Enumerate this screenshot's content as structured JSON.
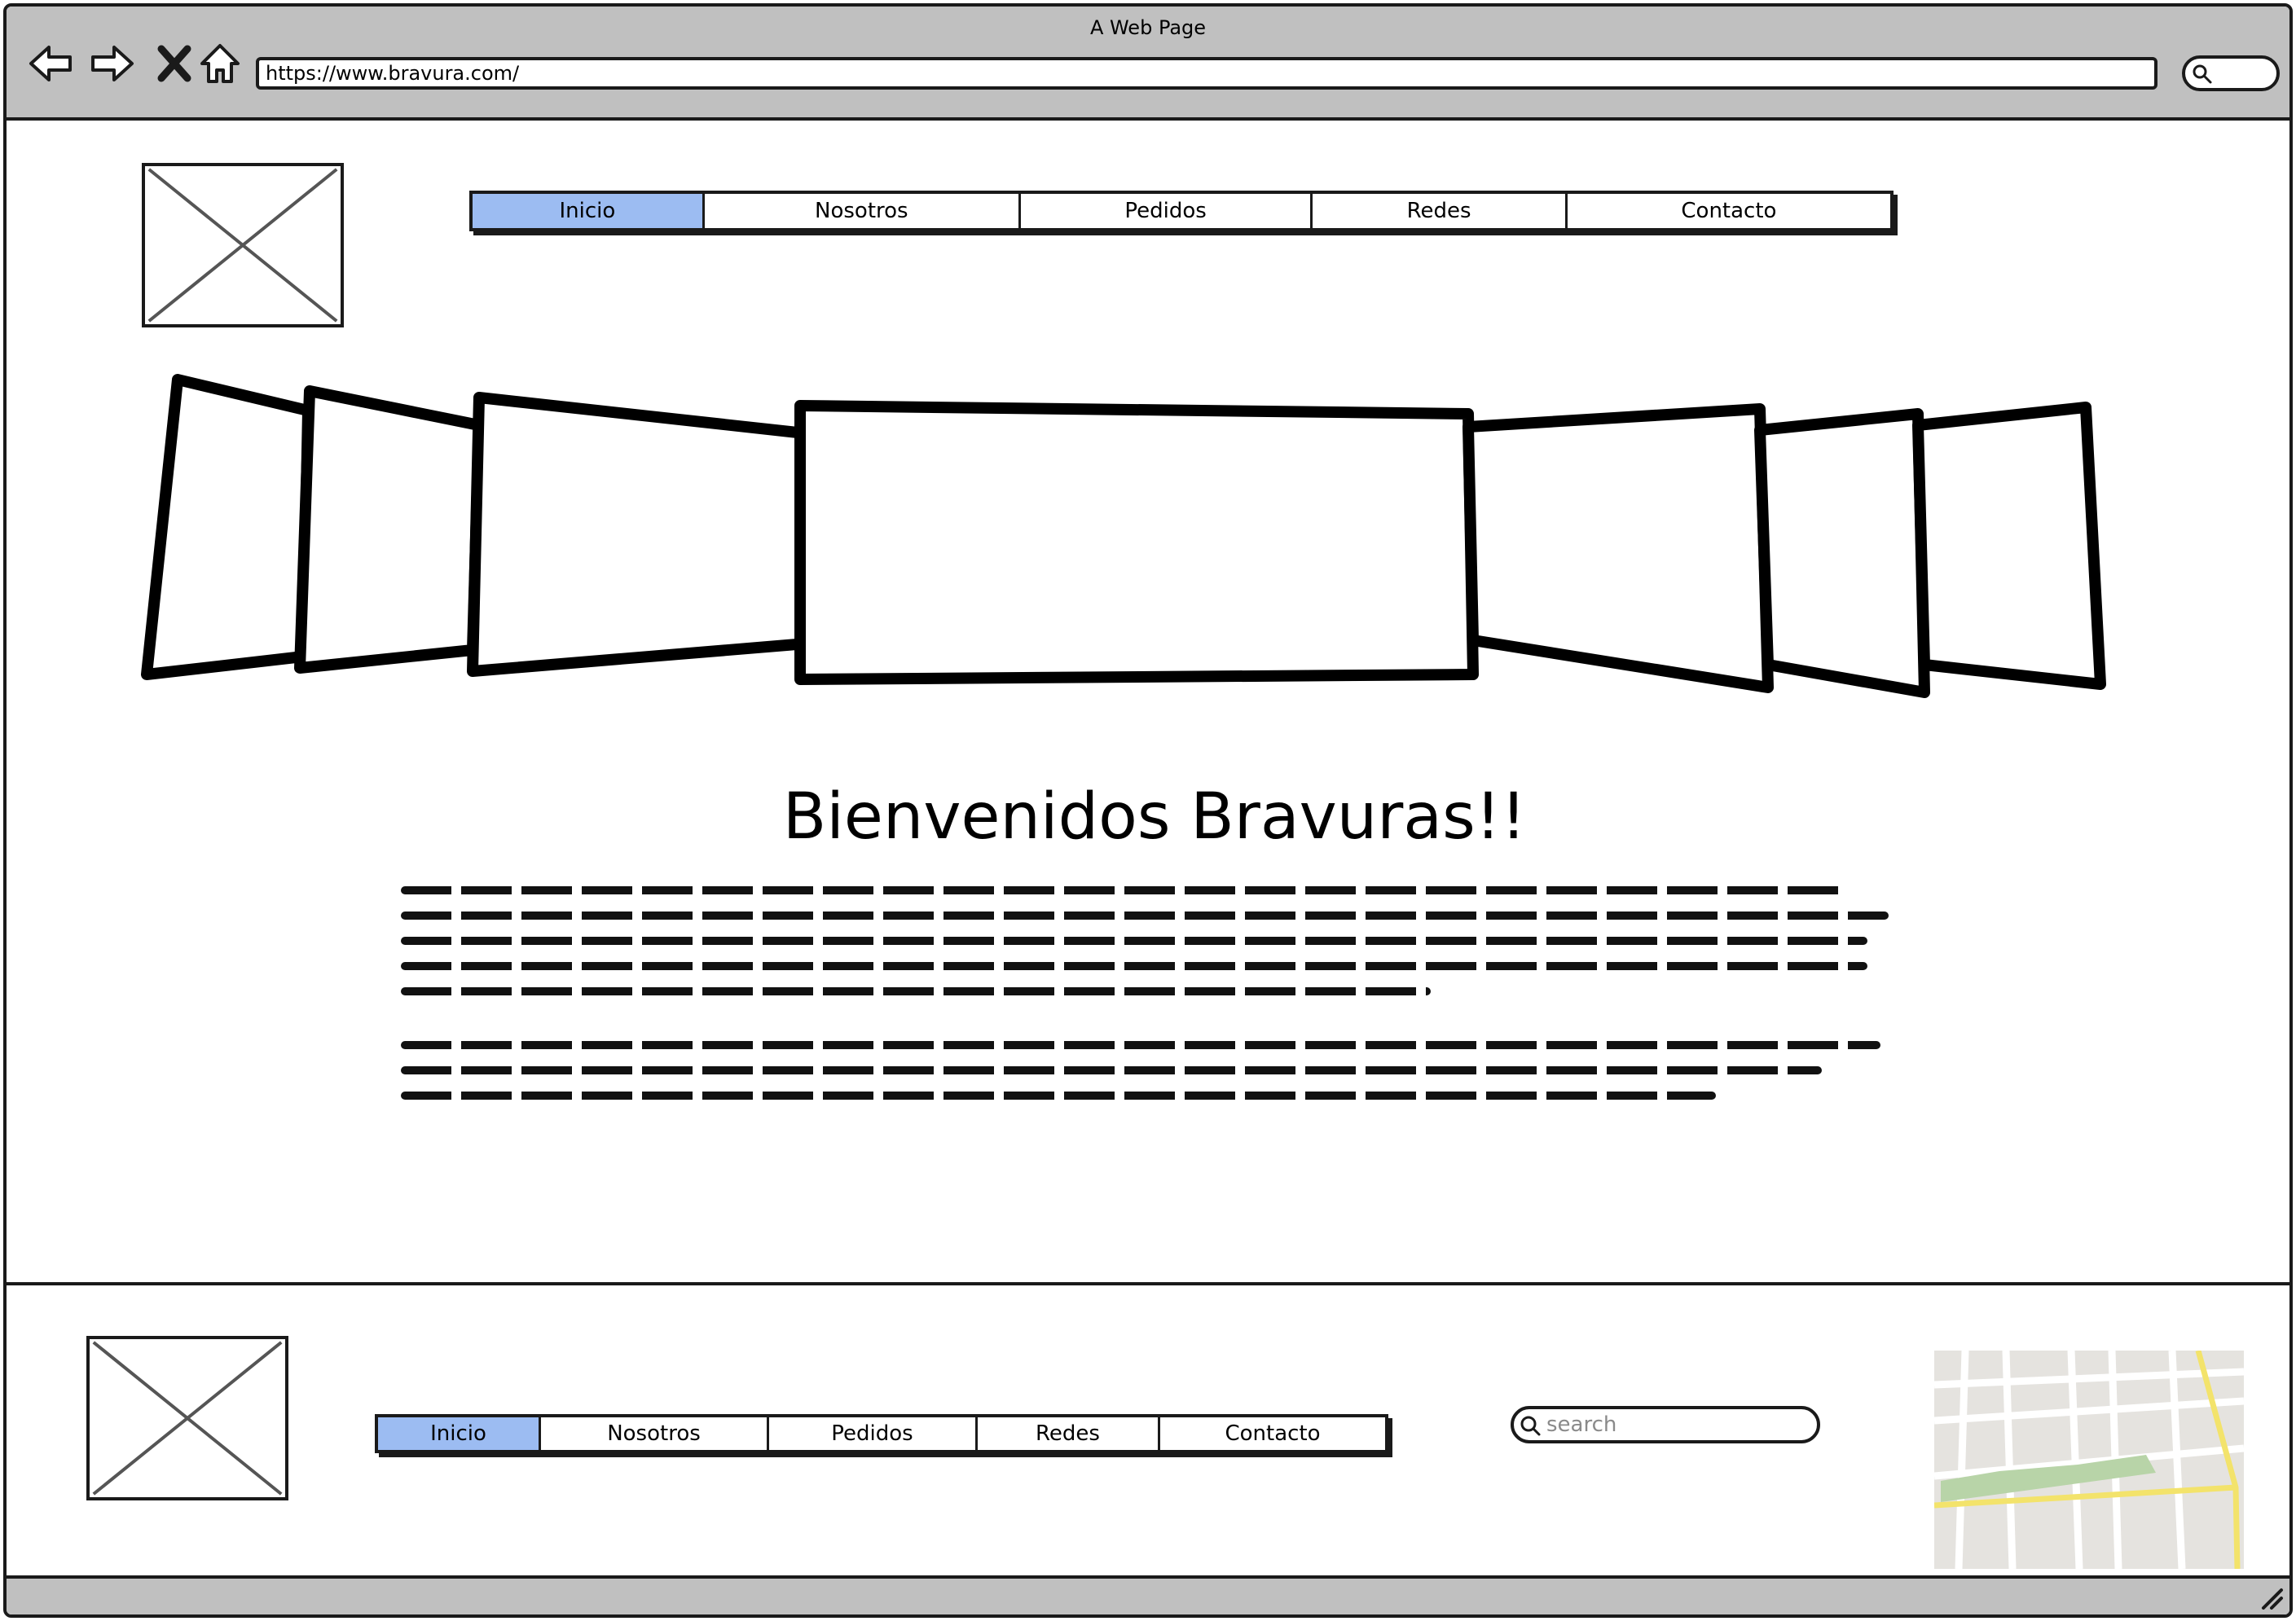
{
  "window": {
    "title": "A Web Page",
    "url": "https://www.bravura.com/"
  },
  "toolbar": {
    "icons": [
      "back-arrow-icon",
      "forward-arrow-icon",
      "close-x-icon",
      "home-icon",
      "search-icon"
    ]
  },
  "header": {
    "menu": [
      {
        "label": "Inicio",
        "active": true
      },
      {
        "label": "Nosotros",
        "active": false
      },
      {
        "label": "Pedidos",
        "active": false
      },
      {
        "label": "Redes",
        "active": false
      },
      {
        "label": "Contacto",
        "active": false
      }
    ]
  },
  "main": {
    "heading": "Bienvenidos Bravuras!!"
  },
  "footer": {
    "menu": [
      {
        "label": "Inicio",
        "active": true
      },
      {
        "label": "Nosotros",
        "active": false
      },
      {
        "label": "Pedidos",
        "active": false
      },
      {
        "label": "Redes",
        "active": false
      },
      {
        "label": "Contacto",
        "active": false
      }
    ],
    "search_placeholder": "search"
  },
  "colors": {
    "chrome": "#c0c0c0",
    "active_menu": "#9cbcf2",
    "map_park": "#b8d4a8",
    "map_road_major": "#f3e36b",
    "map_ground": "#e5e3df"
  }
}
